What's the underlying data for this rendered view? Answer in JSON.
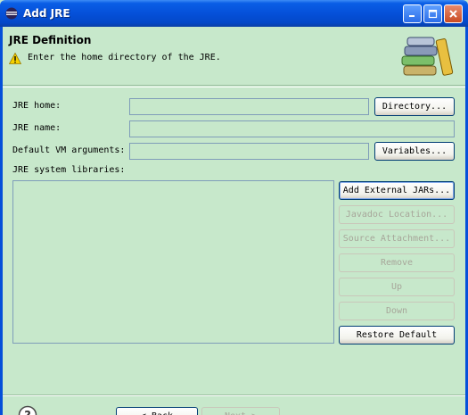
{
  "window": {
    "title": "Add JRE",
    "controls": {
      "minimize": "minimize",
      "maximize": "maximize",
      "close": "close"
    }
  },
  "header": {
    "title": "JRE Definition",
    "message": "Enter the home directory of the JRE.",
    "icon": "warning-icon",
    "banner_icon": "books-icon"
  },
  "form": {
    "jre_home": {
      "label": "JRE home:",
      "value": ""
    },
    "jre_name": {
      "label": "JRE name:",
      "value": ""
    },
    "vm_args": {
      "label": "Default VM arguments:",
      "value": ""
    },
    "libraries_label": "JRE system libraries:"
  },
  "buttons": {
    "directory": "Directory...",
    "variables": "Variables...",
    "add_external_jars": "Add External JARs...",
    "javadoc_location": "Javadoc Location...",
    "source_attachment": "Source Attachment...",
    "remove": "Remove",
    "up": "Up",
    "down": "Down",
    "restore_default": "Restore Default"
  },
  "footer": {
    "help_icon": "help-icon",
    "back": "< Back",
    "next": "Next >"
  },
  "colors": {
    "titlebar": "#0550d9",
    "background": "#c7e8cb",
    "field_border": "#7f9db9",
    "button_border": "#003c74",
    "disabled_text": "#a7a69a"
  }
}
